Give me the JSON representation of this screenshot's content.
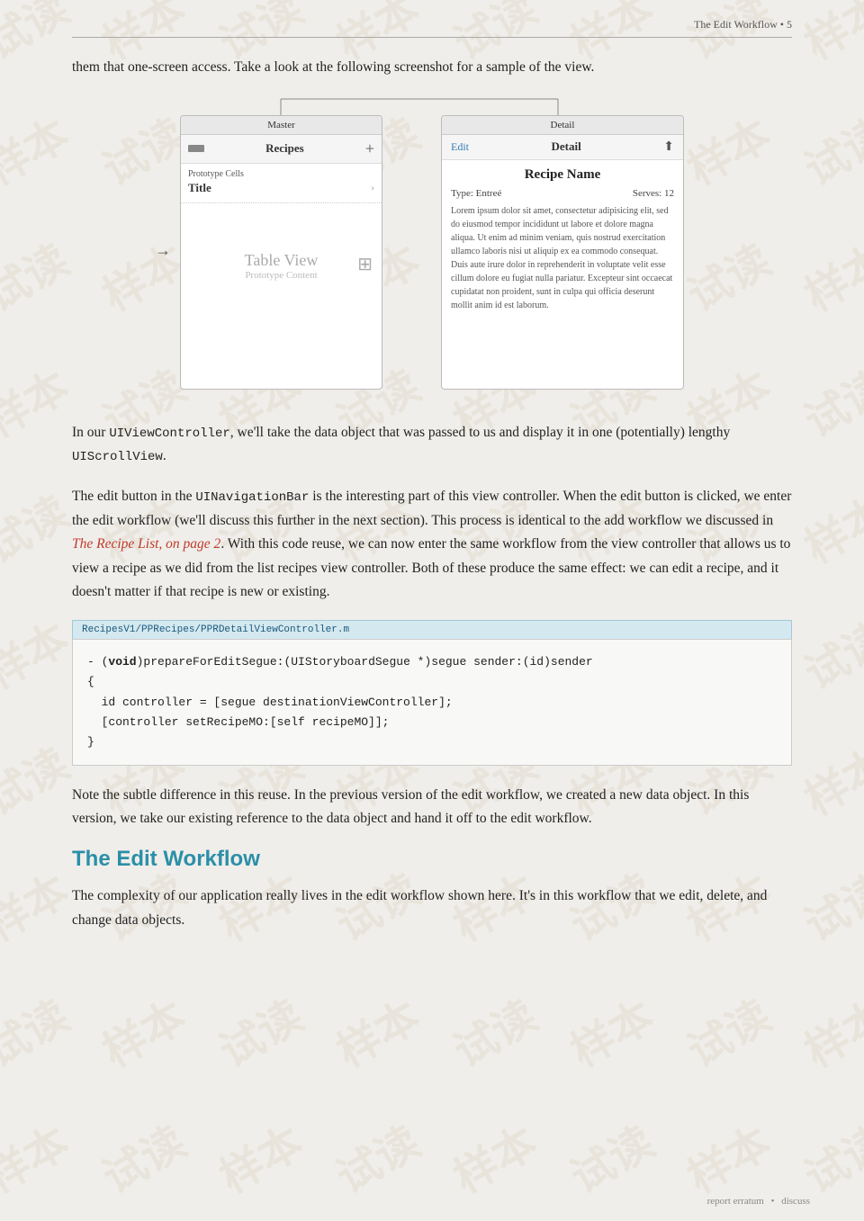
{
  "header": {
    "text": "The Edit Workflow • 5"
  },
  "intro": {
    "text": "them that one-screen access. Take a look at the following screenshot for a sample of the view."
  },
  "diagram": {
    "master_label": "Master",
    "detail_label": "Detail",
    "recipes_label": "Recipes",
    "prototype_cells": "Prototype Cells",
    "title_label": "Title",
    "table_view": "Table View",
    "prototype_content": "Prototype Content",
    "edit_btn": "Edit",
    "detail_btn": "Detail",
    "recipe_name": "Recipe Name",
    "type_label": "Type: Entreé",
    "serves_label": "Serves: 12",
    "lorem_text": "Lorem ipsum dolor sit amet, consectetur adipisicing elit, sed do eiusmod tempor incididunt ut labore et dolore magna aliqua. Ut enim ad minim veniam, quis nostrud exercitation ullamco laboris nisi ut aliquip ex ea commodo consequat. Duis aute irure dolor in reprehenderit in voluptate velit esse cillum dolore eu fugiat nulla pariatur. Excepteur sint occaecat cupidatat non proident, sunt in culpa qui officia deserunt mollit anim id est laborum."
  },
  "body": {
    "para1": "In our UIViewController, we'll take the data object that was passed to us and display it in one (potentially) lengthy UIScrollView.",
    "para1_code1": "UIViewController",
    "para1_code2": "UIScrollView",
    "para2_start": "The edit button in the ",
    "para2_code1": "UINavigationBar",
    "para2_mid": " is the interesting part of this view controller. When the edit button is clicked, we enter the edit workflow (we'll discuss this further in the next section). This process is identical to the add workflow we discussed in ",
    "para2_link": "The Recipe List, on page 2",
    "para2_end": ". With this code reuse, we can now enter the same workflow from the view controller that allows us to view a recipe as we did from the list recipes view controller. Both of these produce the same effect: we can edit a recipe, and it doesn't matter if that recipe is new or existing."
  },
  "code": {
    "file_label": "RecipesV1/PPRecipes/PPRDetailViewController.m",
    "line1": "- (void)prepareForEditSegue:(UIStoryboardSegue *)segue sender:(id)sender",
    "line2": "{",
    "line3": "  id controller = [segue destinationViewController];",
    "line4": "  [controller setRecipeMO:[self recipeMO]];",
    "line5": "}"
  },
  "body2": {
    "para": "Note the subtle difference in this reuse. In the previous version of the edit workflow, we created a new data object. In this version, we take our existing reference to the data object and hand it off to the edit workflow."
  },
  "section": {
    "title": "The Edit Workflow",
    "para": "The complexity of our application really lives in the edit workflow shown here. It's in this workflow that we edit, delete, and change data objects."
  },
  "footer": {
    "report": "report erratum",
    "discuss": "discuss"
  }
}
